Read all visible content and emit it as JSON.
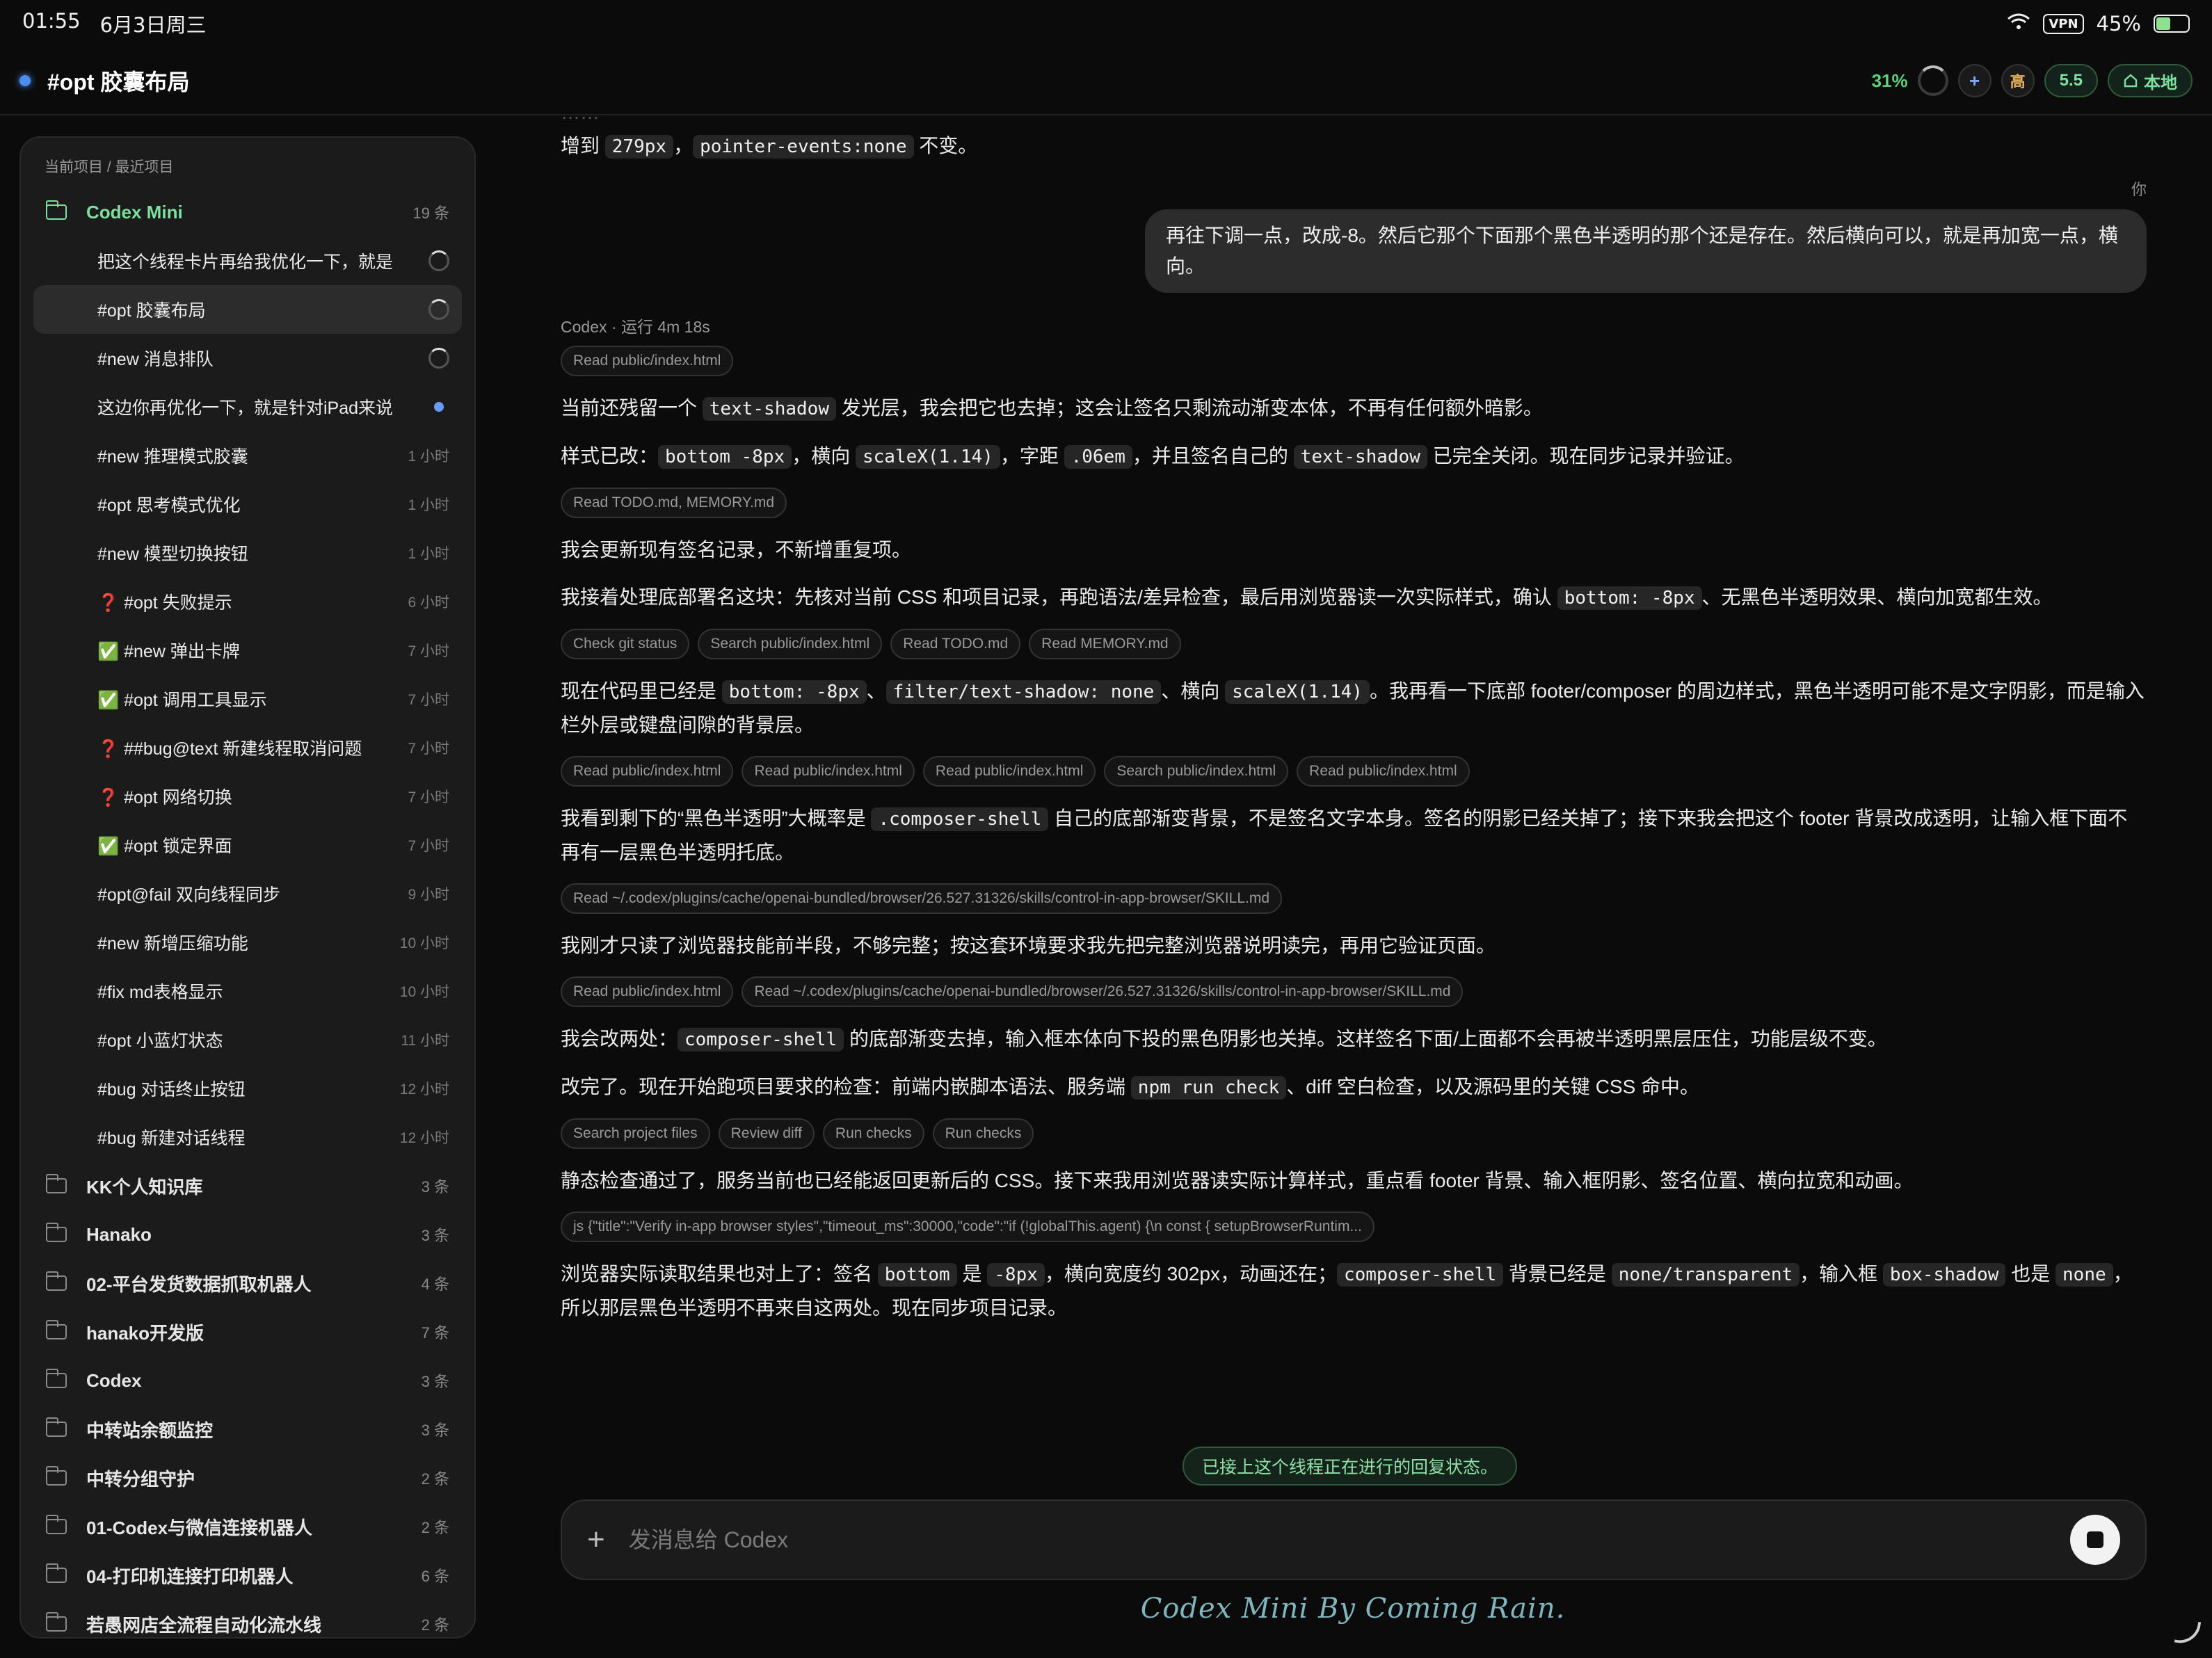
{
  "status_bar": {
    "time": "01:55",
    "date": "6月3日周三",
    "vpn": "VPN",
    "battery": "45%"
  },
  "header": {
    "title": "#opt 胶囊布局",
    "context_pct": "31%",
    "effort": "高",
    "model": "5.5",
    "location": "本地"
  },
  "sidebar": {
    "section_label": "当前项目 / 最近项目",
    "active_project": {
      "name": "Codex Mini",
      "count": "19 条"
    },
    "threads": [
      {
        "title": "把这个线程卡片再给我优化一下，就是",
        "time": "",
        "state": "running"
      },
      {
        "title": "#opt 胶囊布局",
        "time": "",
        "state": "running"
      },
      {
        "title": "#new 消息排队",
        "time": "",
        "state": "running"
      },
      {
        "title": "这边你再优化一下，就是针对iPad来说",
        "time": "",
        "state": "unread"
      },
      {
        "title": "#new 推理模式胶囊",
        "time": "1 小时"
      },
      {
        "title": "#opt 思考模式优化",
        "time": "1 小时"
      },
      {
        "title": "#new 模型切换按钮",
        "time": "1 小时"
      },
      {
        "title": "❓ #opt 失败提示",
        "time": "6 小时"
      },
      {
        "title": "✅ #new 弹出卡牌",
        "time": "7 小时"
      },
      {
        "title": "✅ #opt 调用工具显示",
        "time": "7 小时"
      },
      {
        "title": "❓ ##bug@text 新建线程取消问题",
        "time": "7 小时"
      },
      {
        "title": "❓ #opt 网络切换",
        "time": "7 小时"
      },
      {
        "title": "✅ #opt 锁定界面",
        "time": "7 小时"
      },
      {
        "title": "#opt@fail 双向线程同步",
        "time": "9 小时"
      },
      {
        "title": "#new 新增压缩功能",
        "time": "10 小时"
      },
      {
        "title": "#fix md表格显示",
        "time": "10 小时"
      },
      {
        "title": "#opt 小蓝灯状态",
        "time": "11 小时"
      },
      {
        "title": "#bug 对话终止按钮",
        "time": "12 小时"
      },
      {
        "title": "#bug 新建对话线程",
        "time": "12 小时"
      }
    ],
    "projects": [
      {
        "name": "KK个人知识库",
        "count": "3 条"
      },
      {
        "name": "Hanako",
        "count": "3 条"
      },
      {
        "name": "02-平台发货数据抓取机器人",
        "count": "4 条"
      },
      {
        "name": "hanako开发版",
        "count": "7 条"
      },
      {
        "name": "Codex",
        "count": "3 条"
      },
      {
        "name": "中转站余额监控",
        "count": "3 条"
      },
      {
        "name": "中转分组守护",
        "count": "2 条"
      },
      {
        "name": "01-Codex与微信连接机器人",
        "count": "2 条"
      },
      {
        "name": "04-打印机连接打印机器人",
        "count": "6 条"
      },
      {
        "name": "若愚网店全流程自动化流水线",
        "count": "2 条"
      }
    ]
  },
  "chat": {
    "top_line_a": "增到 ",
    "top_code_a": "279px",
    "top_line_b": "，",
    "top_code_b": "pointer-events:none",
    "top_line_c": " 不变。",
    "you_label": "你",
    "user_message": "再往下调一点，改成-8。然后它那个下面那个黑色半透明的那个还是存在。然后横向可以，就是再加宽一点，横向。",
    "meta": "Codex · 运行 4m 18s",
    "tools1": [
      "Read public/index.html"
    ],
    "p1a": "当前还残留一个 ",
    "p1code": "text-shadow",
    "p1b": " 发光层，我会把它也去掉；这会让签名只剩流动渐变本体，不再有任何额外暗影。",
    "p2a": "样式已改：",
    "p2c1": "bottom -8px",
    "p2b": "，横向 ",
    "p2c2": "scaleX(1.14)",
    "p2d": "，字距 ",
    "p2c3": ".06em",
    "p2e": "，并且签名自己的 ",
    "p2c4": "text-shadow",
    "p2f": " 已完全关闭。现在同步记录并验证。",
    "tools2": [
      "Read TODO.md, MEMORY.md"
    ],
    "p3": "我会更新现有签名记录，不新增重复项。",
    "p4a": "我接着处理底部署名这块：先核对当前 CSS 和项目记录，再跑语法/差异检查，最后用浏览器读一次实际样式，确认 ",
    "p4c": "bottom: -8px",
    "p4b": "、无黑色半透明效果、横向加宽都生效。",
    "tools3": [
      "Check git status",
      "Search public/index.html",
      "Read TODO.md",
      "Read MEMORY.md"
    ],
    "p5a": "现在代码里已经是 ",
    "p5c1": "bottom: -8px",
    "p5b": "、",
    "p5c2": "filter/text-shadow: none",
    "p5d": "、横向 ",
    "p5c3": "scaleX(1.14)",
    "p5e": "。我再看一下底部 footer/composer 的周边样式，黑色半透明可能不是文字阴影，而是输入栏外层或键盘间隙的背景层。",
    "tools4": [
      "Read public/index.html",
      "Read public/index.html",
      "Read public/index.html",
      "Search public/index.html",
      "Read public/index.html"
    ],
    "p6a": "我看到剩下的“黑色半透明”大概率是 ",
    "p6c": ".composer-shell",
    "p6b": " 自己的底部渐变背景，不是签名文字本身。签名的阴影已经关掉了；接下来我会把这个 footer 背景改成透明，让输入框下面不再有一层黑色半透明托底。",
    "tools5": [
      "Read ~/.codex/plugins/cache/openai-bundled/browser/26.527.31326/skills/control-in-app-browser/SKILL.md"
    ],
    "p7": "我刚才只读了浏览器技能前半段，不够完整；按这套环境要求我先把完整浏览器说明读完，再用它验证页面。",
    "tools6": [
      "Read public/index.html",
      "Read ~/.codex/plugins/cache/openai-bundled/browser/26.527.31326/skills/control-in-app-browser/SKILL.md"
    ],
    "p8a": "我会改两处：",
    "p8c": "composer-shell",
    "p8b": " 的底部渐变去掉，输入框本体向下投的黑色阴影也关掉。这样签名下面/上面都不会再被半透明黑层压住，功能层级不变。",
    "p9a": "改完了。现在开始跑项目要求的检查：前端内嵌脚本语法、服务端 ",
    "p9c": "npm run check",
    "p9b": "、diff 空白检查，以及源码里的关键 CSS 命中。",
    "tools7": [
      "Search project files",
      "Review diff",
      "Run checks",
      "Run checks"
    ],
    "p10": "静态检查通过了，服务当前也已经能返回更新后的 CSS。接下来我用浏览器读实际计算样式，重点看 footer 背景、输入框阴影、签名位置、横向拉宽和动画。",
    "tools8": [
      "js {\"title\":\"Verify in-app browser styles\",\"timeout_ms\":30000,\"code\":\"if (!globalThis.agent) {\\n const { setupBrowserRuntim..."
    ],
    "p11a": "浏览器实际读取结果也对上了：签名 ",
    "p11c1": "bottom",
    "p11b": " 是 ",
    "p11c2": "-8px",
    "p11d": "，横向宽度约 302px，动画还在；",
    "p11c3": "composer-shell",
    "p11e": " 背景已经是 ",
    "p11c4": "none/transparent",
    "p11f": "，输入框 ",
    "p11c5": "box-shadow",
    "p11g": " 也是 ",
    "p11c6": "none",
    "p11h": "，所以那层黑色半透明不再来自这两处。现在同步项目记录。"
  },
  "notice": "已接上这个线程正在进行的回复状态。",
  "composer": {
    "placeholder": "发消息给 Codex"
  },
  "signature": "Codex Mini By Coming Rain."
}
